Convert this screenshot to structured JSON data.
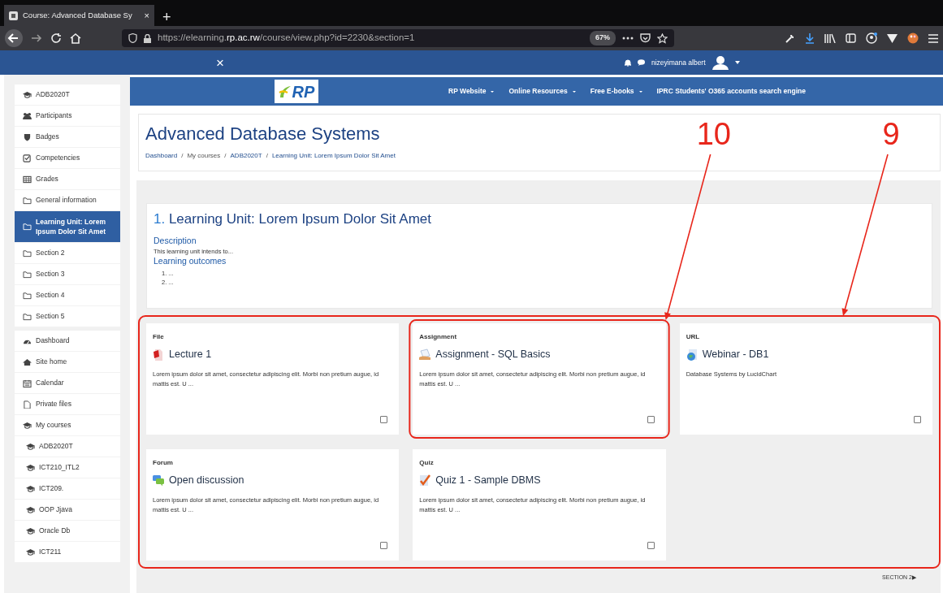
{
  "browser": {
    "tab_title": "Course: Advanced Database Sy",
    "tab_close": "×",
    "new_tab": "+",
    "url": "https://elearning.**rp.ac.rw**/course/view.php?id=2230&section=1",
    "zoom": "67%"
  },
  "topbar": {
    "close": "×",
    "user_name": "nizeyimana albert"
  },
  "header": {
    "logo": "RP",
    "nav": [
      {
        "label": "RP Website",
        "dropdown": true
      },
      {
        "label": "Online Resources",
        "dropdown": true
      },
      {
        "label": "Free E-books",
        "dropdown": true
      },
      {
        "label": "IPRC Students' O365 accounts search engine",
        "dropdown": false
      }
    ]
  },
  "page": {
    "title": "Advanced Database Systems",
    "breadcrumb": [
      {
        "label": "Dashboard",
        "link": true
      },
      {
        "separator": "/",
        "label": "My courses",
        "link": false
      },
      {
        "separator": "/",
        "label": "ADB2020T",
        "link": true
      },
      {
        "separator": "/",
        "label": "Learning Unit: Lorem Ipsum Dolor Sit Amet",
        "link": true
      }
    ]
  },
  "sidebar": {
    "groups": [
      {
        "items": [
          {
            "label": "ADB2020T",
            "kind": "course",
            "selected": false
          },
          {
            "label": "Participants",
            "kind": "users",
            "selected": false
          },
          {
            "label": "Badges",
            "kind": "shield",
            "selected": false
          },
          {
            "label": "Competencies",
            "kind": "checkbox",
            "selected": false
          },
          {
            "label": "Grades",
            "kind": "table",
            "selected": false
          },
          {
            "label": "General information",
            "kind": "folder",
            "selected": false
          },
          {
            "label": "Learning Unit: Lorem Ipsum Dolor Sit Amet",
            "kind": "folder",
            "selected": true
          },
          {
            "label": "Section 2",
            "kind": "folder",
            "selected": false
          },
          {
            "label": "Section 3",
            "kind": "folder",
            "selected": false
          },
          {
            "label": "Section 4",
            "kind": "folder",
            "selected": false
          },
          {
            "label": "Section 5",
            "kind": "folder",
            "selected": false
          }
        ]
      },
      {
        "items": [
          {
            "label": "Dashboard",
            "kind": "dashboard",
            "selected": false
          },
          {
            "label": "Site home",
            "kind": "home",
            "selected": false
          },
          {
            "label": "Calendar",
            "kind": "calendar",
            "selected": false
          },
          {
            "label": "Private files",
            "kind": "file",
            "selected": false
          },
          {
            "label": "My courses",
            "kind": "course",
            "selected": false,
            "children": [
              {
                "label": "ADB2020T",
                "kind": "course",
                "selected": false
              },
              {
                "label": "ICT210_ITL2",
                "kind": "course",
                "selected": false
              },
              {
                "label": "ICT209.",
                "kind": "course",
                "selected": false
              },
              {
                "label": "OOP Jjava",
                "kind": "course",
                "selected": false
              },
              {
                "label": "Oracle Db",
                "kind": "course",
                "selected": false
              },
              {
                "label": "ICT211",
                "kind": "course",
                "selected": false
              }
            ]
          }
        ]
      }
    ]
  },
  "section": {
    "number": "1.",
    "title": "Learning Unit: Lorem Ipsum Dolor Sit Amet",
    "description_heading": "Description",
    "description": "This learning unit intends to...",
    "outcomes_heading": "Learning outcomes",
    "outcomes": [
      "1. ...",
      "2. ..."
    ]
  },
  "activities": {
    "callout": "9",
    "items": [
      {
        "type": "File",
        "kind": "file",
        "title": "Lecture 1",
        "description": "Lorem ipsum dolor sit amet, consectetur adipiscing elit. Morbi non pretium augue, id mattis est. U ...",
        "checked": false
      },
      {
        "type": "Assignment",
        "kind": "assignment",
        "title": "Assignment - SQL Basics",
        "description": "Lorem ipsum dolor sit amet, consectetur adipiscing elit. Morbi non pretium augue, id mattis est. U ...",
        "checked": false,
        "callout": "10"
      },
      {
        "type": "URL",
        "kind": "url",
        "title": "Webinar - DB1",
        "description": "Database Systems by LucidChart",
        "checked": false
      },
      {
        "type": "Forum",
        "kind": "forum",
        "title": "Open discussion",
        "description": "Lorem ipsum dolor sit amet, consectetur adipiscing elit. Morbi non pretium augue, id mattis est. U ...",
        "checked": false
      },
      {
        "type": "Quiz",
        "kind": "quiz",
        "title": "Quiz 1 - Sample DBMS",
        "description": "Lorem ipsum dolor sit amet, consectetur adipiscing elit. Morbi non pretium augue, id mattis est. U ...",
        "checked": false
      }
    ]
  },
  "next_section": {
    "label": "SECTION 2",
    "arrow": "▶"
  }
}
